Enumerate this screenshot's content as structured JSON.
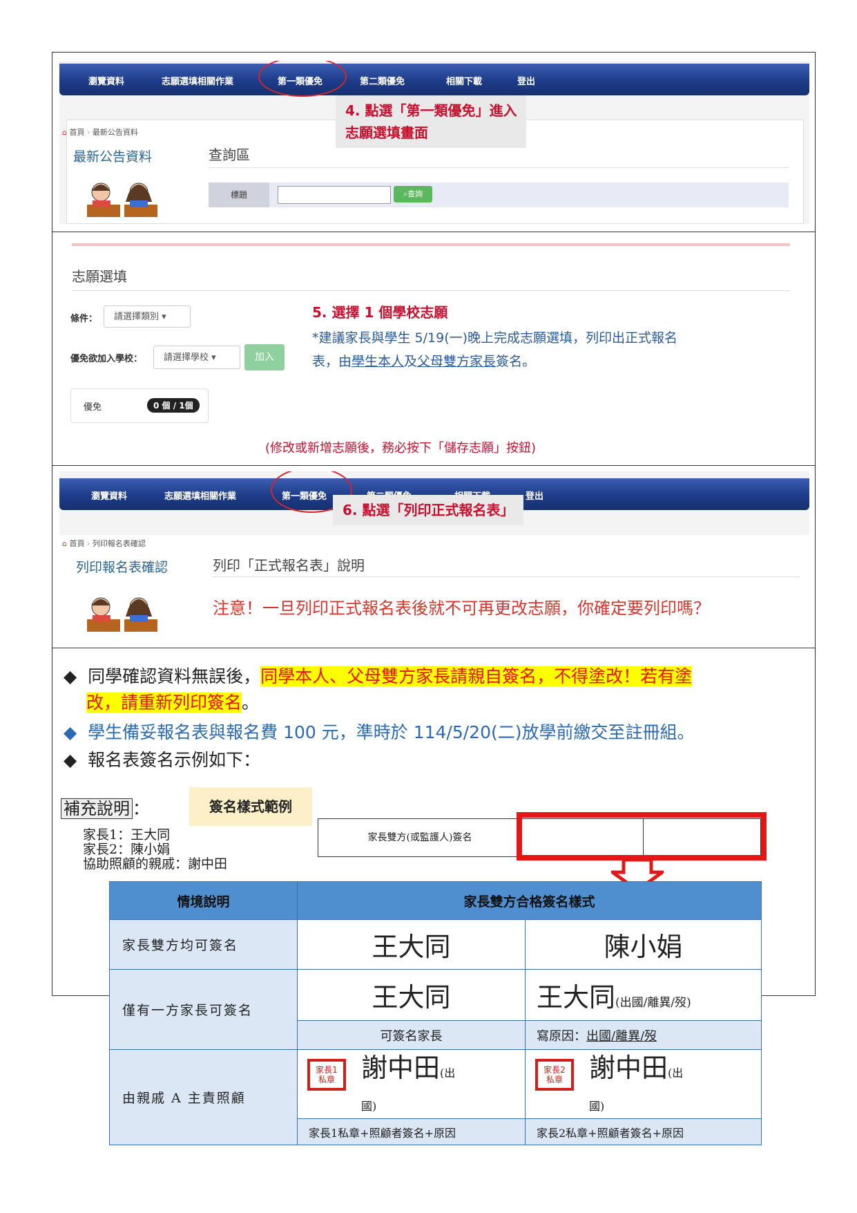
{
  "nav1": {
    "items": [
      "瀏覽資料",
      "志願選填相關作業",
      "第一類優免",
      "第二類優免",
      "相關下載",
      "登出"
    ],
    "callout_line1": "4. 點選「第一類優免」進入",
    "callout_line2": "志願選填畫面",
    "breadcrumb_home": "首頁",
    "breadcrumb_current": "最新公告資料",
    "side_title": "最新公告資料",
    "query_title": "查詢區",
    "field_label": "標題",
    "query_button": "查詢"
  },
  "select": {
    "title": "志願選填",
    "cond_label": "條件：",
    "cond_placeholder": "請選擇類別",
    "school_label": "優免欲加入學校：",
    "school_placeholder": "請選擇學校",
    "add_button": "加入",
    "count_label": "優免",
    "count_badge": "0 個 / 1個",
    "step_title": "5. 選擇 1 個學校志願",
    "note_line1": "*建議家長與學生 5/19(一)晚上完成志願選填，列印出正式報名",
    "note_prefix": "表，由",
    "note_student": "學生本人",
    "note_and": "及",
    "note_parents": "父母雙方家長",
    "note_suffix": "簽名。",
    "save_notice": "(修改或新增志願後，務必按下「儲存志願」按鈕)"
  },
  "nav2": {
    "items": [
      "瀏覽資料",
      "志願選填相關作業",
      "第一類優免",
      "第二類優免",
      "相關下載",
      "登出"
    ],
    "callout": "6. 點選「列印正式報名表」",
    "breadcrumb_home": "首頁",
    "breadcrumb_current": "列印報名表確認",
    "side_title": "列印報名表確認",
    "section_title": "列印「正式報名表」說明",
    "warning": "注意！一旦列印正式報名表後就不可再更改志願，你確定要列印嗎？"
  },
  "bullets": {
    "b1_prefix": "同學確認資料無誤後，",
    "b1_highlight1": "同學本人、父母雙方家長請親自簽名，不得塗改！若有塗",
    "b1_highlight2": "改，請重新列印簽名",
    "b1_end": "。",
    "b2": "學生備妥報名表與報名費 100 元，準時於 114/5/20(二)放學前繳交至註冊組。",
    "b3": "報名表簽名示例如下："
  },
  "supplement": {
    "label": "補充說明",
    "colon": "：",
    "sample_title": "簽名樣式範例",
    "parent1": "家長1：王大同",
    "parent2": "家長2：陳小娟",
    "relative": "協助照顧的親戚：謝中田",
    "sign_row_label": "家長雙方(或監護人)簽名"
  },
  "table": {
    "head_context": "情境說明",
    "head_format": "家長雙方合格簽名樣式",
    "row1_context": "家長雙方均可簽名",
    "row1_sig1": "王大同",
    "row1_sig2": "陳小娟",
    "row2_context": "僅有一方家長可簽名",
    "row2_sig1": "王大同",
    "row2_sig2": "王大同",
    "row2_reason": "(出國/離異/歿)",
    "row2_sub1": "可簽名家長",
    "row2_sub2_prefix": "寫原因：",
    "row2_sub2_reason": "出國/離異/歿",
    "row3_context": "由親戚 A 主責照顧",
    "seal1": "家長1 私章",
    "seal2": "家長2 私章",
    "row3_sig": "謝中田",
    "row3_reason_a": "(出",
    "row3_reason_b": "國)",
    "row3_sub1": "家長1私章+照顧者簽名+原因",
    "row3_sub2": "家長2私章+照顧者簽名+原因"
  }
}
